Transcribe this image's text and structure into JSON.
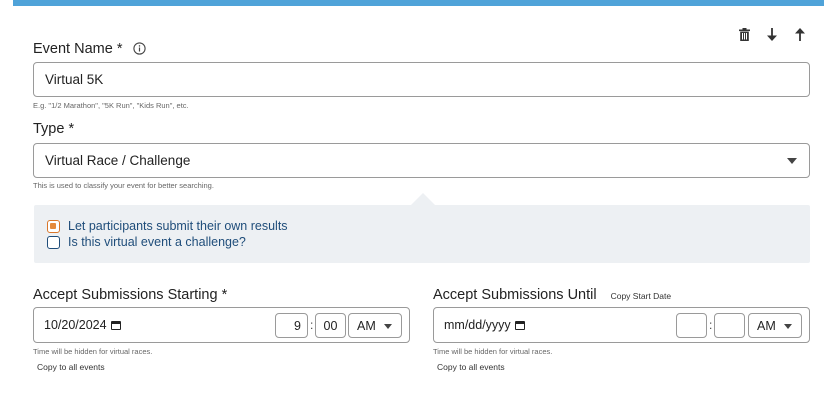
{
  "toolbar": {
    "icons": [
      "trash-icon",
      "arrow-down-icon",
      "arrow-up-icon"
    ]
  },
  "event_name": {
    "label": "Event Name *",
    "value": "Virtual 5K",
    "hint": "E.g. \"1/2 Marathon\", \"5K Run\", \"Kids Run\", etc."
  },
  "type": {
    "label": "Type *",
    "value": "Virtual Race / Challenge",
    "hint": "This is used to classify your event for better searching."
  },
  "options": {
    "self_submit_label": "Let participants submit their own results",
    "self_submit_checked": true,
    "challenge_label": "Is this virtual event a challenge?",
    "challenge_checked": false
  },
  "start": {
    "label": "Accept Submissions Starting *",
    "date": "10/20/2024",
    "hour": "9",
    "minute": "00",
    "ampm": "AM",
    "hint": "Time will be hidden for virtual races.",
    "copy_link": "Copy to all events"
  },
  "until": {
    "label": "Accept Submissions Until",
    "copy_start_link": "Copy Start Date",
    "date": "mm/dd/yyyy",
    "hour": "",
    "minute": "",
    "ampm": "AM",
    "hint": "Time will be hidden for virtual races.",
    "copy_link": "Copy to all events"
  },
  "colors": {
    "accent_bar": "#4fa3d9",
    "panel_bg": "#edf0f3",
    "checkbox_checked": "#e58a3c",
    "link_text": "#1f4d7a"
  }
}
